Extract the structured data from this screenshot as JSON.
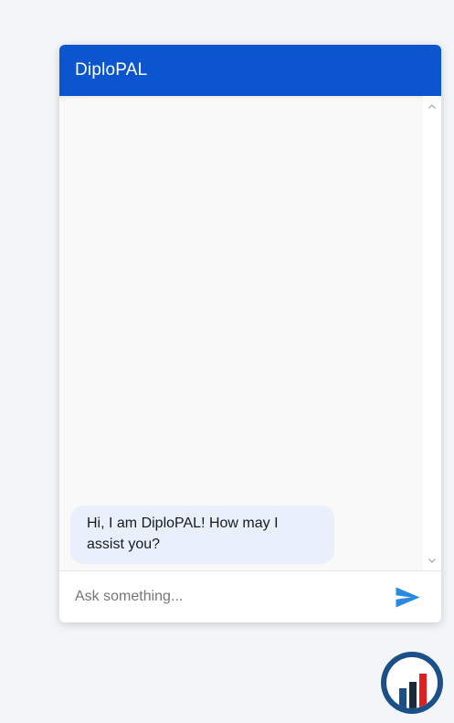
{
  "header": {
    "title": "DiploPAL"
  },
  "messages": [
    {
      "sender": "bot",
      "text": "Hi, I am DiploPAL! How may I assist you?"
    }
  ],
  "input": {
    "placeholder": "Ask something...",
    "value": ""
  },
  "icons": {
    "send": "send-icon",
    "scroll_up": "chevron-up-icon",
    "scroll_down": "chevron-down-icon",
    "launcher": "bar-chart-logo-icon"
  },
  "colors": {
    "header": "#0b56cf",
    "send_icon": "#2a8ae0",
    "bot_bubble": "#e9f0fb",
    "launcher_ring": "#1a4f88",
    "chart_bar_accent": "#e02020",
    "chart_bar_dark": "#1b2a3a",
    "chart_bar_blue": "#1a4f88"
  }
}
